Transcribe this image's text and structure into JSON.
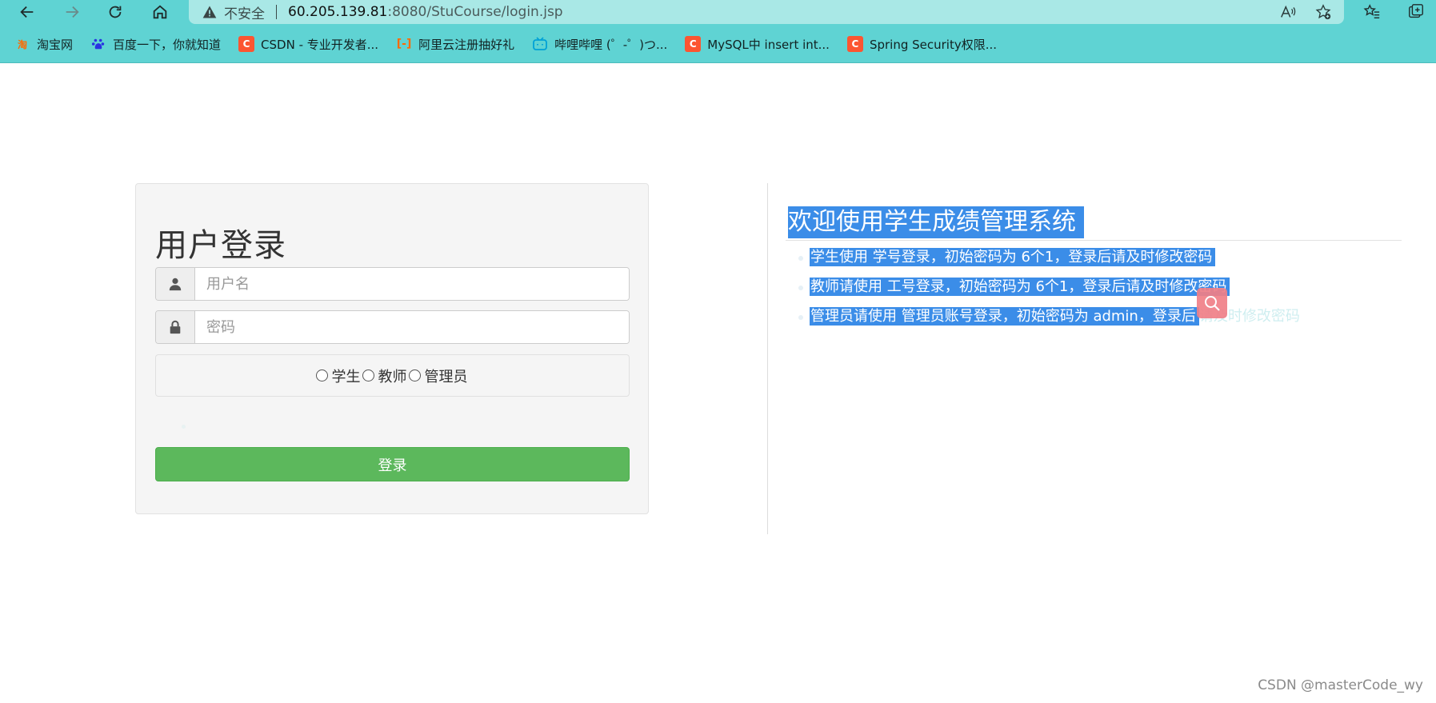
{
  "browser": {
    "security_label": "不安全",
    "url_host": "60.205.139.81",
    "url_path": ":8080/StuCourse/login.jsp",
    "bookmarks": [
      {
        "label": "淘宝网",
        "icon": "taobao-icon",
        "color": "#ff6a00"
      },
      {
        "label": "百度一下，你就知道",
        "icon": "baidu-icon",
        "color": "#2932e1"
      },
      {
        "label": "CSDN - 专业开发者...",
        "icon": "csdn-icon",
        "color": "#fc5531"
      },
      {
        "label": "阿里云注册抽好礼",
        "icon": "aliyun-icon",
        "color": "#ff6a00"
      },
      {
        "label": "哔哩哔哩 (゜-゜)つ...",
        "icon": "bilibili-icon",
        "color": "#00a1d6"
      },
      {
        "label": "MySQL中 insert int...",
        "icon": "csdn-icon",
        "color": "#fc5531"
      },
      {
        "label": "Spring Security权限...",
        "icon": "csdn-icon",
        "color": "#fc5531"
      }
    ]
  },
  "login": {
    "title": "用户登录",
    "username_placeholder": "用户名",
    "password_placeholder": "密码",
    "roles": [
      "学生",
      "教师",
      "管理员"
    ],
    "submit_label": "登录"
  },
  "info": {
    "heading": "欢迎使用学生成绩管理系统",
    "note_1": "学生使用 学号登录，初始密码为 6个1，登录后请及时修改密码",
    "note_2": "教师请使用 工号登录，初始密码为 6个1，登录后请及时修改密码",
    "note_3_selected": "管理员请使用 管理员账号登录，初始密码为 admin，登录后",
    "note_3_rest": "请及时修改密码"
  },
  "watermark": "CSDN @masterCode_wy",
  "colors": {
    "chrome": "#5fd3d3",
    "address_bar": "#a9e8e6",
    "selection": "#3b8de8",
    "login_button": "#5cb85c"
  }
}
